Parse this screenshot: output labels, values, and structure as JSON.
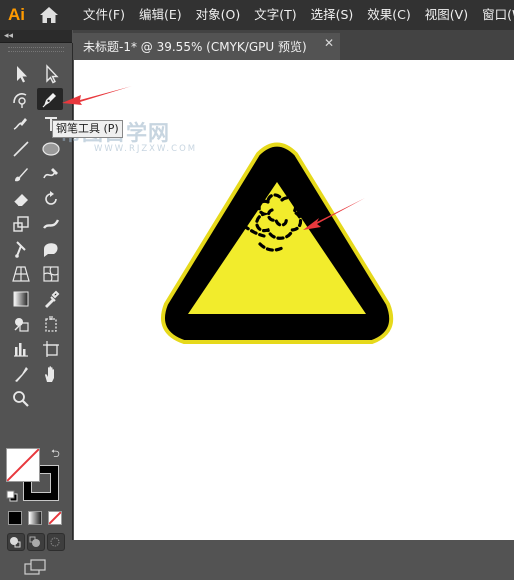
{
  "app": {
    "logo_text": "Ai"
  },
  "menu": {
    "items": [
      {
        "label": "文件(F)"
      },
      {
        "label": "编辑(E)"
      },
      {
        "label": "对象(O)"
      },
      {
        "label": "文字(T)"
      },
      {
        "label": "选择(S)"
      },
      {
        "label": "效果(C)"
      },
      {
        "label": "视图(V)"
      },
      {
        "label": "窗口(W)"
      }
    ]
  },
  "toolbar": {
    "collapse_glyph": "◂◂",
    "active_tool": "pen-tool",
    "tooltip": "钢笔工具 (P)"
  },
  "document": {
    "tab_title": "未标题-1* @ 39.55% (CMYK/GPU 预览)",
    "close_glyph": "✕"
  },
  "watermark": {
    "main": "帮图自学网",
    "sub": "WWW.RJZXW.COM"
  },
  "colors": {
    "sign_yellow": "#f2ec2c",
    "sign_outline": "#e6d91b",
    "sign_black": "#000000",
    "annotation_red": "#e8383d",
    "logo_orange": "#ff9a00"
  }
}
